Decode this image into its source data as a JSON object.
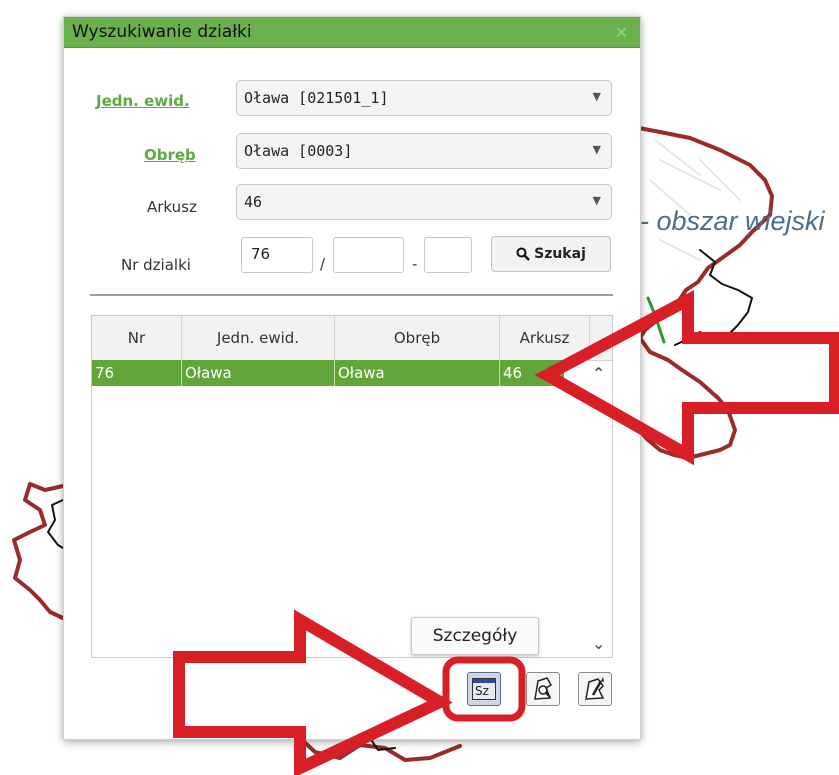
{
  "map": {
    "area_label": "- obszar wiejski"
  },
  "dialog": {
    "title": "Wyszukiwanie działki",
    "close_glyph": "✕",
    "fields": {
      "jedn_label": "Jedn. ewid.",
      "jedn_value": "Oława [021501_1]",
      "obreb_label": "Obręb",
      "obreb_value": "Oława [0003]",
      "arkusz_label": "Arkusz",
      "arkusz_value": "46",
      "nr_label": "Nr dzialki",
      "nr_value_1": "76",
      "nr_sep_1": "/",
      "nr_value_2": "",
      "nr_sep_2": "-",
      "nr_value_3": "",
      "dropdown_arrow": "▼"
    },
    "search_button": {
      "label": "Szukaj",
      "icon": "search-icon"
    },
    "results": {
      "columns": [
        "Nr",
        "Jedn. ewid.",
        "Obręb",
        "Arkusz"
      ],
      "rows": [
        [
          "76",
          "Oława",
          "Oława",
          "46"
        ]
      ],
      "selected_row_color": "#62a63a",
      "scroll_up": "⌃",
      "scroll_down": "⌄"
    },
    "tooltip": "Szczegóły",
    "tools": {
      "details_label": "Sz",
      "details_icon": "details-icon",
      "locate_icon": "parcel-locate-icon",
      "draw_icon": "parcel-draw-icon"
    },
    "accent_color": "#6ab04c",
    "annotation_color": "#d91f26"
  }
}
